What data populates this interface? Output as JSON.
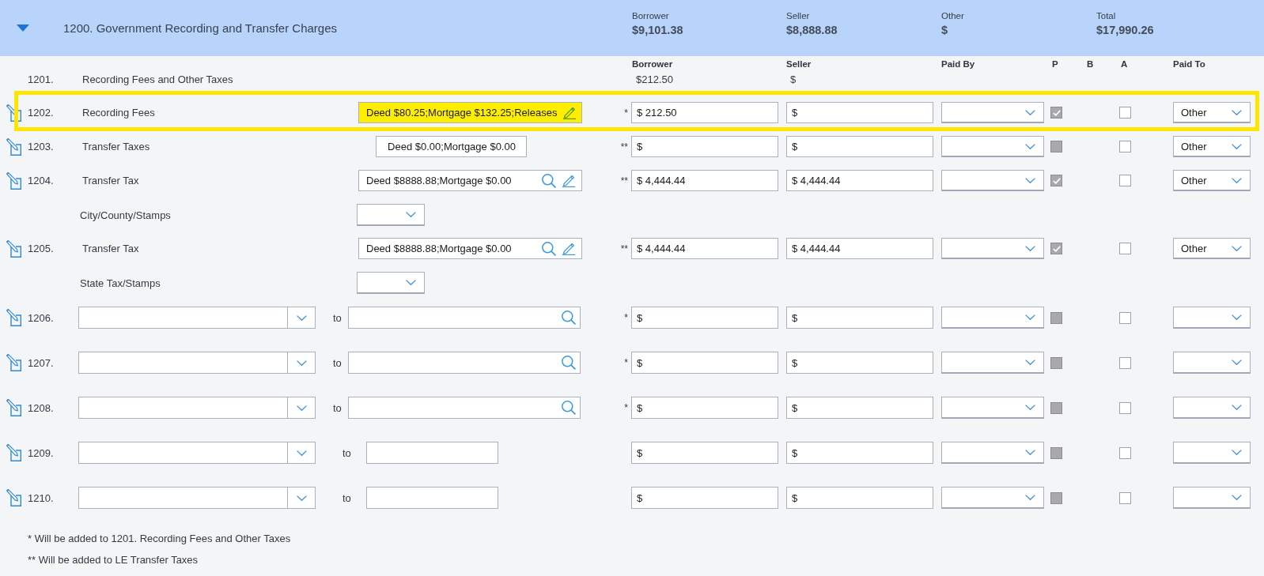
{
  "section": {
    "title": "1200. Government Recording and Transfer Charges",
    "expanded": true,
    "totals": [
      {
        "label": "Borrower",
        "value": "$9,101.38"
      },
      {
        "label": "Seller",
        "value": "$8,888.88"
      },
      {
        "label": "Other",
        "value": "$"
      },
      {
        "label": "Total",
        "value": "$17,990.26"
      }
    ]
  },
  "columns": [
    "Borrower",
    "Seller",
    "Paid By",
    "P",
    "B",
    "A",
    "Paid To"
  ],
  "rows": [
    {
      "kind": "summary",
      "number": "1201.",
      "label": "Recording Fees and Other Taxes",
      "highlighted": false,
      "borrower": "$212.50",
      "seller": "$"
    },
    {
      "kind": "fee",
      "number": "1202.",
      "label": "Recording Fees",
      "highlighted": true,
      "description": {
        "value": "Deed $80.25;Mortgage $132.25;Releases",
        "search": false,
        "edit": true
      },
      "marker": "*",
      "borrower": "$ 212.50",
      "seller": "$",
      "p": {
        "checked": true,
        "disabled": true
      },
      "a": {
        "checked": false,
        "disabled": false
      },
      "paid_to": "Other"
    },
    {
      "kind": "fee",
      "number": "1203.",
      "label": "Transfer Taxes",
      "highlighted": false,
      "description": {
        "value": "Deed $0.00;Mortgage $0.00",
        "search": false,
        "edit": false
      },
      "marker": "**",
      "borrower": "$",
      "seller": "$",
      "p": {
        "checked": false,
        "disabled": true
      },
      "a": {
        "checked": false,
        "disabled": false
      },
      "paid_to": "Other"
    },
    {
      "kind": "fee",
      "number": "1204.",
      "label": "Transfer Tax",
      "highlighted": false,
      "description": {
        "value": "Deed $8888.88;Mortgage $0.00",
        "search": true,
        "edit": true
      },
      "marker": "**",
      "borrower": "$ 4,444.44",
      "seller": "$ 4,444.44",
      "p": {
        "checked": true,
        "disabled": true
      },
      "a": {
        "checked": false,
        "disabled": false
      },
      "paid_to": "Other"
    },
    {
      "kind": "sub",
      "label": "City/County/Stamps",
      "highlighted": false
    },
    {
      "kind": "fee",
      "number": "1205.",
      "label": "Transfer Tax",
      "highlighted": false,
      "description": {
        "value": "Deed $8888.88;Mortgage $0.00",
        "search": true,
        "edit": true
      },
      "marker": "**",
      "borrower": "$ 4,444.44",
      "seller": "$ 4,444.44",
      "p": {
        "checked": true,
        "disabled": true
      },
      "a": {
        "checked": false,
        "disabled": false
      },
      "paid_to": "Other"
    },
    {
      "kind": "sub",
      "label": "State Tax/Stamps",
      "highlighted": false
    },
    {
      "kind": "custom",
      "number": "1206.",
      "highlighted": false,
      "to_text": "to",
      "searchable": true,
      "marker": "*",
      "borrower": "$",
      "seller": "$",
      "p": {
        "checked": false,
        "disabled": true
      },
      "a": {
        "checked": false,
        "disabled": false
      }
    },
    {
      "kind": "custom",
      "number": "1207.",
      "highlighted": false,
      "to_text": "to",
      "searchable": true,
      "marker": "*",
      "borrower": "$",
      "seller": "$",
      "p": {
        "checked": false,
        "disabled": true
      },
      "a": {
        "checked": false,
        "disabled": false
      }
    },
    {
      "kind": "custom",
      "number": "1208.",
      "highlighted": false,
      "to_text": "to",
      "searchable": true,
      "marker": "*",
      "borrower": "$",
      "seller": "$",
      "p": {
        "checked": false,
        "disabled": true
      },
      "a": {
        "checked": false,
        "disabled": false
      }
    },
    {
      "kind": "custom",
      "number": "1209.",
      "highlighted": false,
      "to_text": "to",
      "searchable": false,
      "borrower": "$",
      "seller": "$",
      "p": {
        "checked": false,
        "disabled": true
      },
      "a": {
        "checked": false,
        "disabled": false
      }
    },
    {
      "kind": "custom",
      "number": "1210.",
      "highlighted": false,
      "to_text": "to",
      "searchable": false,
      "borrower": "$",
      "seller": "$",
      "p": {
        "checked": false,
        "disabled": true
      },
      "a": {
        "checked": false,
        "disabled": false
      }
    }
  ],
  "footnotes": [
    "* Will be added to 1201. Recording Fees and Other Taxes",
    "** Will be added to LE Transfer Taxes"
  ]
}
